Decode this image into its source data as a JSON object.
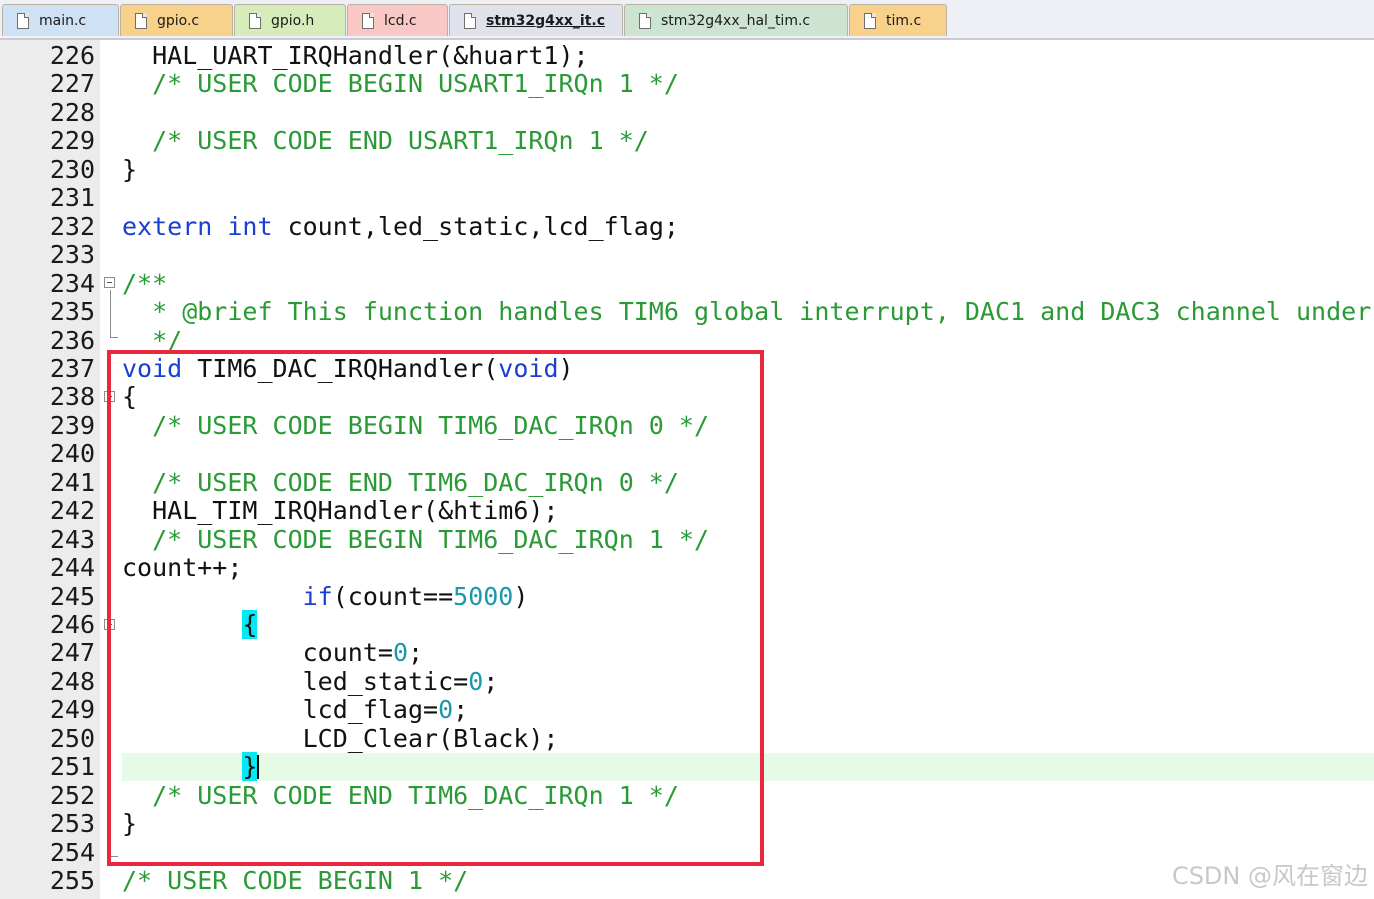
{
  "tabs": [
    {
      "label": "main.c",
      "color": "#cfe1f4",
      "active": false
    },
    {
      "label": "gpio.c",
      "color": "#f8d18b",
      "active": false
    },
    {
      "label": "gpio.h",
      "color": "#d6ecba",
      "active": false
    },
    {
      "label": "lcd.c",
      "color": "#f9c7c4",
      "active": false
    },
    {
      "label": "stm32g4xx_it.c",
      "color": "#dfe2ea",
      "active": true
    },
    {
      "label": "stm32g4xx_hal_tim.c",
      "color": "#cde4d2",
      "active": false
    },
    {
      "label": "tim.c",
      "color": "#f8d18b",
      "active": false
    }
  ],
  "editor": {
    "lines": [
      {
        "num": "226",
        "tokens": [
          {
            "t": "  HAL_UART_IRQHandler(&huart1);",
            "c": "tx"
          }
        ]
      },
      {
        "num": "227",
        "tokens": [
          {
            "t": "  /* USER CODE BEGIN USART1_IRQn 1 */",
            "c": "cm"
          }
        ]
      },
      {
        "num": "228",
        "tokens": []
      },
      {
        "num": "229",
        "tokens": [
          {
            "t": "  /* USER CODE END USART1_IRQn 1 */",
            "c": "cm"
          }
        ]
      },
      {
        "num": "230",
        "tokens": [
          {
            "t": "}",
            "c": "tx"
          }
        ]
      },
      {
        "num": "231",
        "tokens": []
      },
      {
        "num": "232",
        "tokens": [
          {
            "t": "extern",
            "c": "kw"
          },
          {
            "t": " ",
            "c": "tx"
          },
          {
            "t": "int",
            "c": "kw"
          },
          {
            "t": " count,led_static,lcd_flag;",
            "c": "tx"
          }
        ]
      },
      {
        "num": "233",
        "tokens": []
      },
      {
        "num": "234",
        "tokens": [
          {
            "t": "/**",
            "c": "cm"
          }
        ]
      },
      {
        "num": "235",
        "tokens": [
          {
            "t": "  * @brief This function handles TIM6 global interrupt, DAC1 and DAC3 channel underr",
            "c": "cm"
          }
        ]
      },
      {
        "num": "236",
        "tokens": [
          {
            "t": "  */",
            "c": "cm"
          }
        ]
      },
      {
        "num": "237",
        "tokens": [
          {
            "t": "void",
            "c": "kw"
          },
          {
            "t": " TIM6_DAC_IRQHandler(",
            "c": "tx"
          },
          {
            "t": "void",
            "c": "kw"
          },
          {
            "t": ")",
            "c": "tx"
          }
        ]
      },
      {
        "num": "238",
        "tokens": [
          {
            "t": "{",
            "c": "tx"
          }
        ]
      },
      {
        "num": "239",
        "tokens": [
          {
            "t": "  /* USER CODE BEGIN TIM6_DAC_IRQn 0 */",
            "c": "cm"
          }
        ]
      },
      {
        "num": "240",
        "tokens": []
      },
      {
        "num": "241",
        "tokens": [
          {
            "t": "  /* USER CODE END TIM6_DAC_IRQn 0 */",
            "c": "cm"
          }
        ]
      },
      {
        "num": "242",
        "tokens": [
          {
            "t": "  HAL_TIM_IRQHandler(&htim6);",
            "c": "tx"
          }
        ]
      },
      {
        "num": "243",
        "tokens": [
          {
            "t": "  /* USER CODE BEGIN TIM6_DAC_IRQn 1 */",
            "c": "cm"
          }
        ]
      },
      {
        "num": "244",
        "tokens": [
          {
            "t": "count++;",
            "c": "tx"
          }
        ]
      },
      {
        "num": "245",
        "tokens": [
          {
            "t": "            ",
            "c": "tx"
          },
          {
            "t": "if",
            "c": "kw"
          },
          {
            "t": "(count==",
            "c": "tx"
          },
          {
            "t": "5000",
            "c": "nm"
          },
          {
            "t": ")",
            "c": "tx"
          }
        ]
      },
      {
        "num": "246",
        "tokens": [
          {
            "t": "        ",
            "c": "tx"
          },
          {
            "t": "{",
            "c": "bm"
          }
        ]
      },
      {
        "num": "247",
        "tokens": [
          {
            "t": "            count=",
            "c": "tx"
          },
          {
            "t": "0",
            "c": "nm"
          },
          {
            "t": ";",
            "c": "tx"
          }
        ]
      },
      {
        "num": "248",
        "tokens": [
          {
            "t": "            led_static=",
            "c": "tx"
          },
          {
            "t": "0",
            "c": "nm"
          },
          {
            "t": ";",
            "c": "tx"
          }
        ]
      },
      {
        "num": "249",
        "tokens": [
          {
            "t": "            lcd_flag=",
            "c": "tx"
          },
          {
            "t": "0",
            "c": "nm"
          },
          {
            "t": ";",
            "c": "tx"
          }
        ]
      },
      {
        "num": "250",
        "tokens": [
          {
            "t": "            LCD_Clear(Black);",
            "c": "tx"
          }
        ]
      },
      {
        "num": "251",
        "tokens": [
          {
            "t": "        ",
            "c": "tx"
          },
          {
            "t": "}",
            "c": "bm"
          },
          {
            "t": "",
            "c": "caret"
          }
        ]
      },
      {
        "num": "252",
        "tokens": [
          {
            "t": "  /* USER CODE END TIM6_DAC_IRQn 1 */",
            "c": "cm"
          }
        ]
      },
      {
        "num": "253",
        "tokens": [
          {
            "t": "}",
            "c": "tx"
          }
        ]
      },
      {
        "num": "254",
        "tokens": []
      },
      {
        "num": "255",
        "tokens": [
          {
            "t": "/* USER CODE BEGIN 1 */",
            "c": "cm"
          }
        ]
      }
    ]
  },
  "watermark": "CSDN @风在窗边"
}
